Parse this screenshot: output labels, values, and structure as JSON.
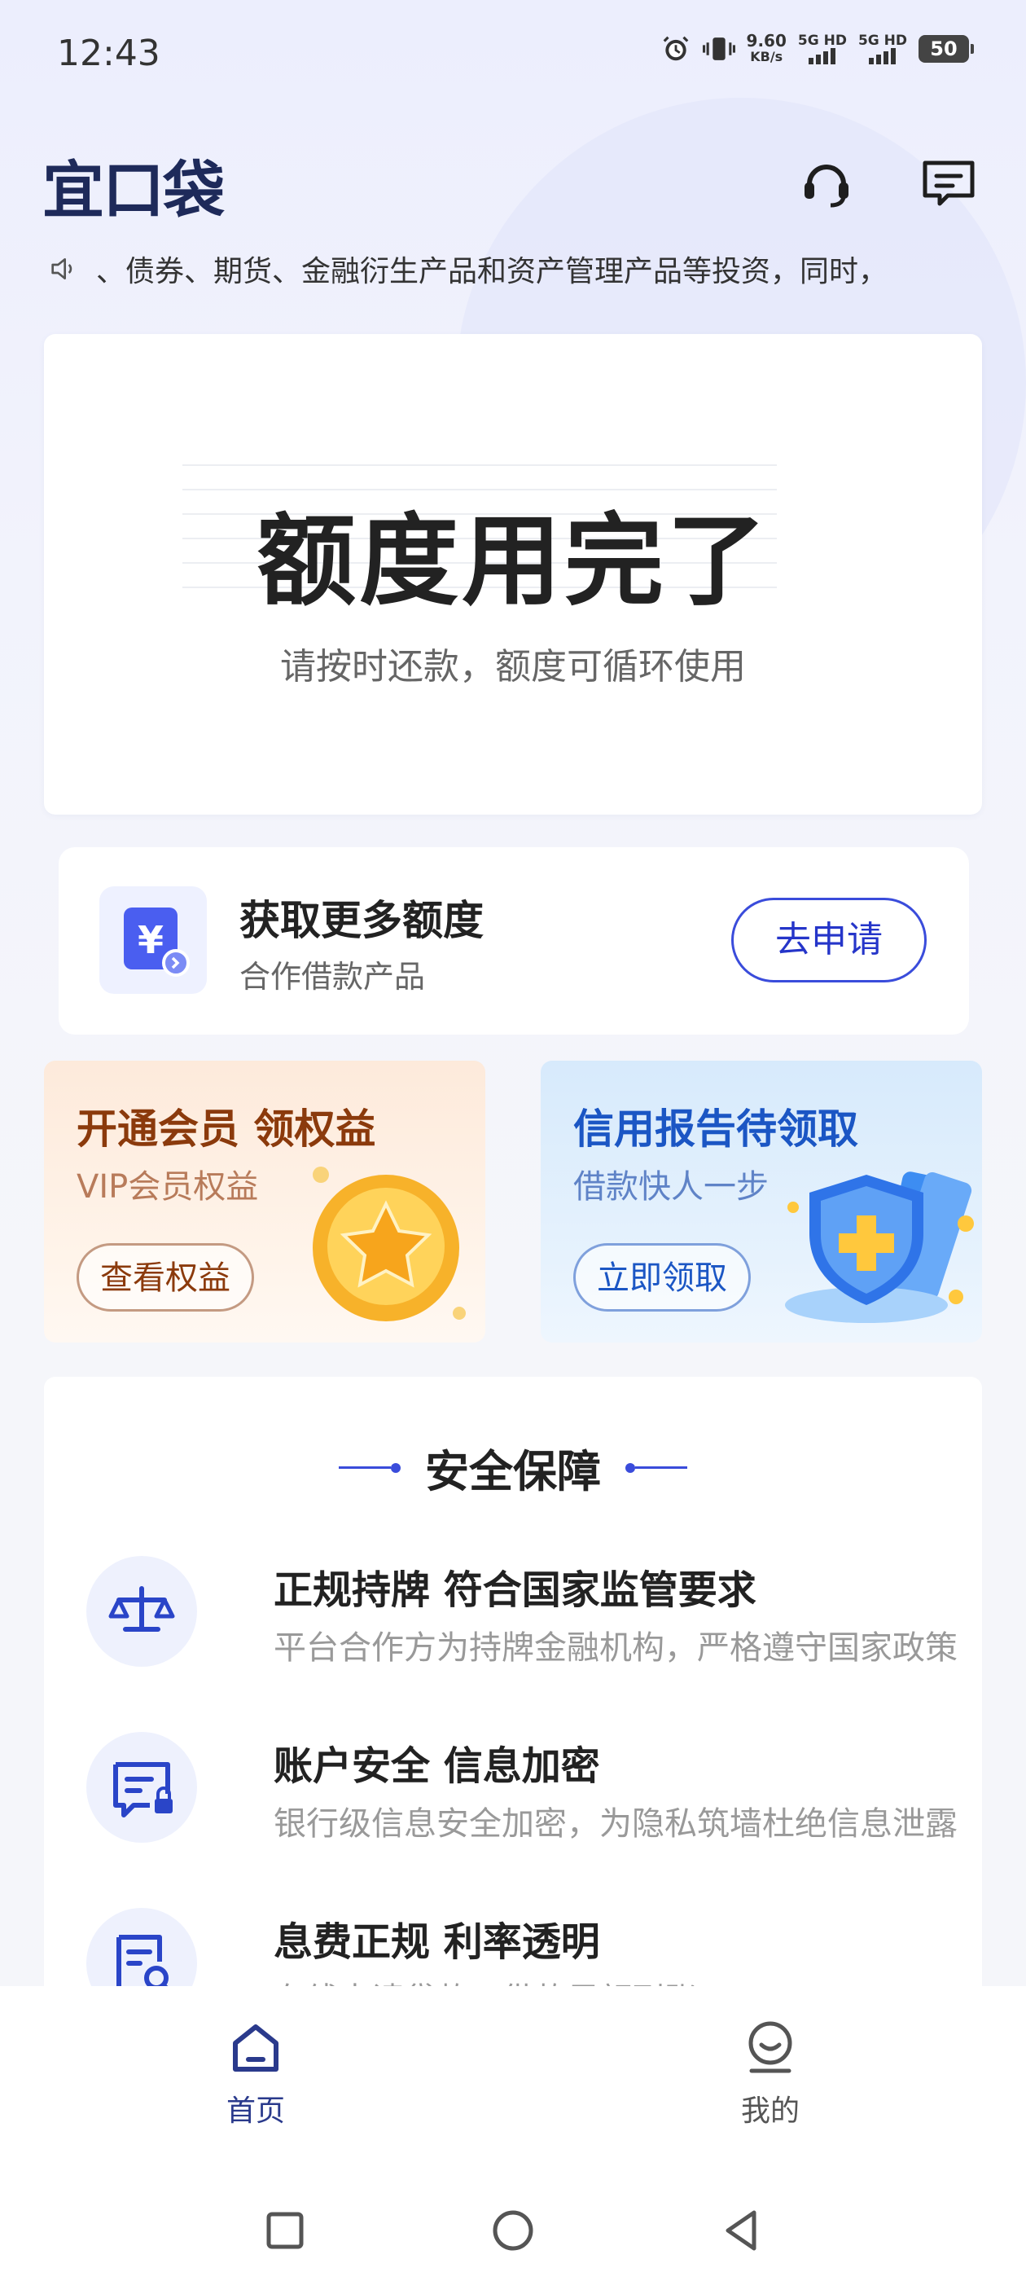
{
  "status_bar": {
    "time": "12:43",
    "speed_value": "9.60",
    "speed_unit": "KB/s",
    "net1": "5G HD",
    "net2": "5G HD",
    "battery": "50"
  },
  "header": {
    "logo": "宜口袋",
    "notice_text": "、债券、期货、金融衍生产品和资产管理产品等投资，同时，"
  },
  "quota_card": {
    "title": "额度用完了",
    "subtitle": "请按时还款，额度可循环使用"
  },
  "more_quota": {
    "title": "获取更多额度",
    "subtitle": "合作借款产品",
    "button": "去申请",
    "icon_glyph": "¥"
  },
  "promos": [
    {
      "title": "开通会员 领权益",
      "subtitle": "VIP会员权益",
      "button": "查看权益"
    },
    {
      "title": "信用报告待领取",
      "subtitle": "借款快人一步",
      "button": "立即领取"
    }
  ],
  "security": {
    "title": "安全保障",
    "items": [
      {
        "title": "正规持牌 符合国家监管要求",
        "subtitle": "平台合作方为持牌金融机构，严格遵守国家政策"
      },
      {
        "title": "账户安全 信息加密",
        "subtitle": "银行级信息安全加密，为隐私筑墙杜绝信息泄露"
      },
      {
        "title": "息费正规  利率透明",
        "subtitle": "在线申请贷款，借款足额到账"
      }
    ]
  },
  "bottom_nav": {
    "tabs": [
      {
        "label": "首页",
        "active": true
      },
      {
        "label": "我的",
        "active": false
      }
    ]
  },
  "colors": {
    "accent": "#3a4cdb",
    "nav_active": "#2a3a8c",
    "nav_inactive": "#555555"
  }
}
